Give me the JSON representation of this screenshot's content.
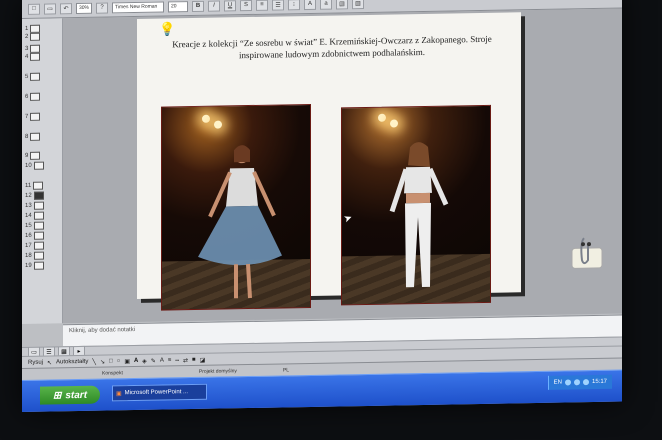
{
  "toolbar": {
    "zoom": "30%",
    "font_name": "Times New Roman",
    "font_size": "20",
    "bold": "B",
    "italic": "I",
    "underline": "U",
    "shadow": "S",
    "align_center": "≡",
    "help": "?"
  },
  "outline": {
    "items": [
      "1",
      "2",
      "3",
      "4",
      "5",
      "6",
      "7",
      "8",
      "9",
      "10",
      "11",
      "12",
      "13",
      "14",
      "15",
      "16",
      "17",
      "18",
      "19"
    ]
  },
  "slide": {
    "title": "Kreacje z kolekcji “Ze sosrebu w świat” E. Krzemińskiej-Owczarz z Zakopanego. Stroje inspirowane ludowym zdobnictwem podhalańskim."
  },
  "notes": {
    "placeholder": "Kliknij, aby dodać notatki"
  },
  "drawing_toolbar": {
    "draw_menu": "Rysuj",
    "autoshapes_menu": "Autokształty"
  },
  "status": {
    "slide_sorter": "Konspekt",
    "design": "Projekt domyślny",
    "language": "PL"
  },
  "taskbar": {
    "start_label": "start",
    "window_label": "Microsoft PowerPoint ...",
    "tray_lang": "EN",
    "clock": "15:17"
  }
}
